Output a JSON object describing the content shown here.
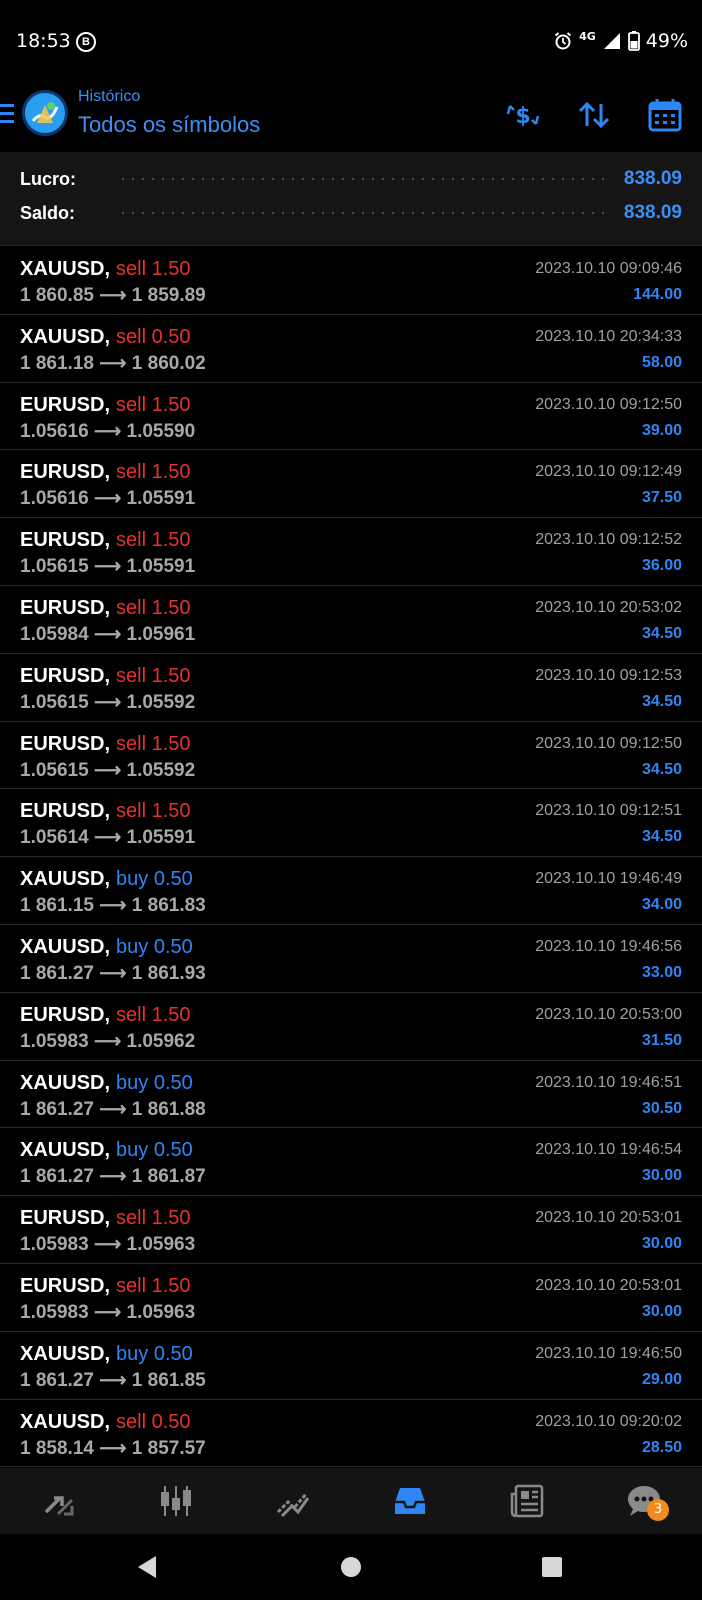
{
  "status_bar": {
    "time": "18:53",
    "b_glyph": "B",
    "network": "4G",
    "battery": "49%"
  },
  "header": {
    "subtitle": "Histórico",
    "title": "Todos os símbolos"
  },
  "summary": {
    "profit_label": "Lucro:",
    "profit_value": "838.09",
    "balance_label": "Saldo:",
    "balance_value": "838.09"
  },
  "trades": [
    {
      "symbol": "XAUUSD,",
      "side": "sell",
      "volume": "1.50",
      "open": "1 860.85",
      "close": "1 859.89",
      "time": "2023.10.10 09:09:46",
      "profit": "144.00"
    },
    {
      "symbol": "XAUUSD,",
      "side": "sell",
      "volume": "0.50",
      "open": "1 861.18",
      "close": "1 860.02",
      "time": "2023.10.10 20:34:33",
      "profit": "58.00"
    },
    {
      "symbol": "EURUSD,",
      "side": "sell",
      "volume": "1.50",
      "open": "1.05616",
      "close": "1.05590",
      "time": "2023.10.10 09:12:50",
      "profit": "39.00"
    },
    {
      "symbol": "EURUSD,",
      "side": "sell",
      "volume": "1.50",
      "open": "1.05616",
      "close": "1.05591",
      "time": "2023.10.10 09:12:49",
      "profit": "37.50"
    },
    {
      "symbol": "EURUSD,",
      "side": "sell",
      "volume": "1.50",
      "open": "1.05615",
      "close": "1.05591",
      "time": "2023.10.10 09:12:52",
      "profit": "36.00"
    },
    {
      "symbol": "EURUSD,",
      "side": "sell",
      "volume": "1.50",
      "open": "1.05984",
      "close": "1.05961",
      "time": "2023.10.10 20:53:02",
      "profit": "34.50"
    },
    {
      "symbol": "EURUSD,",
      "side": "sell",
      "volume": "1.50",
      "open": "1.05615",
      "close": "1.05592",
      "time": "2023.10.10 09:12:53",
      "profit": "34.50"
    },
    {
      "symbol": "EURUSD,",
      "side": "sell",
      "volume": "1.50",
      "open": "1.05615",
      "close": "1.05592",
      "time": "2023.10.10 09:12:50",
      "profit": "34.50"
    },
    {
      "symbol": "EURUSD,",
      "side": "sell",
      "volume": "1.50",
      "open": "1.05614",
      "close": "1.05591",
      "time": "2023.10.10 09:12:51",
      "profit": "34.50"
    },
    {
      "symbol": "XAUUSD,",
      "side": "buy",
      "volume": "0.50",
      "open": "1 861.15",
      "close": "1 861.83",
      "time": "2023.10.10 19:46:49",
      "profit": "34.00"
    },
    {
      "symbol": "XAUUSD,",
      "side": "buy",
      "volume": "0.50",
      "open": "1 861.27",
      "close": "1 861.93",
      "time": "2023.10.10 19:46:56",
      "profit": "33.00"
    },
    {
      "symbol": "EURUSD,",
      "side": "sell",
      "volume": "1.50",
      "open": "1.05983",
      "close": "1.05962",
      "time": "2023.10.10 20:53:00",
      "profit": "31.50"
    },
    {
      "symbol": "XAUUSD,",
      "side": "buy",
      "volume": "0.50",
      "open": "1 861.27",
      "close": "1 861.88",
      "time": "2023.10.10 19:46:51",
      "profit": "30.50"
    },
    {
      "symbol": "XAUUSD,",
      "side": "buy",
      "volume": "0.50",
      "open": "1 861.27",
      "close": "1 861.87",
      "time": "2023.10.10 19:46:54",
      "profit": "30.00"
    },
    {
      "symbol": "EURUSD,",
      "side": "sell",
      "volume": "1.50",
      "open": "1.05983",
      "close": "1.05963",
      "time": "2023.10.10 20:53:01",
      "profit": "30.00"
    },
    {
      "symbol": "EURUSD,",
      "side": "sell",
      "volume": "1.50",
      "open": "1.05983",
      "close": "1.05963",
      "time": "2023.10.10 20:53:01",
      "profit": "30.00"
    },
    {
      "symbol": "XAUUSD,",
      "side": "buy",
      "volume": "0.50",
      "open": "1 861.27",
      "close": "1 861.85",
      "time": "2023.10.10 19:46:50",
      "profit": "29.00"
    },
    {
      "symbol": "XAUUSD,",
      "side": "sell",
      "volume": "0.50",
      "open": "1 858.14",
      "close": "1 857.57",
      "time": "2023.10.10 09:20:02",
      "profit": "28.50"
    }
  ],
  "colors": {
    "accent": "#2e86f5",
    "sell": "#e5322d",
    "buy": "#2e86f5",
    "badge": "#f08c1e"
  },
  "bottom_nav": {
    "items": [
      "quotes-icon",
      "chart-icon",
      "trade-icon",
      "history-icon",
      "news-icon",
      "messages-icon"
    ],
    "active": "history-icon",
    "messages_badge": "3"
  }
}
